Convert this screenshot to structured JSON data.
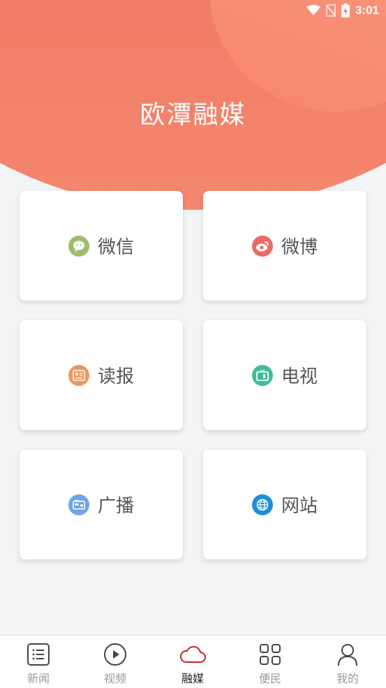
{
  "status_bar": {
    "time": "3:01"
  },
  "header": {
    "title": "欧潭融媒"
  },
  "cards": [
    {
      "label": "微信",
      "icon": "wechat-icon",
      "color": "#9dbd6e"
    },
    {
      "label": "微博",
      "icon": "weibo-icon",
      "color": "#ec6a63"
    },
    {
      "label": "读报",
      "icon": "newspaper-icon",
      "color": "#f0975a"
    },
    {
      "label": "电视",
      "icon": "tv-icon",
      "color": "#3cbf97"
    },
    {
      "label": "广播",
      "icon": "radio-icon",
      "color": "#6ea6e8"
    },
    {
      "label": "网站",
      "icon": "globe-icon",
      "color": "#1e8fd6"
    }
  ],
  "tabbar": {
    "items": [
      {
        "label": "新闻",
        "icon": "news-list-icon"
      },
      {
        "label": "视频",
        "icon": "play-circle-icon"
      },
      {
        "label": "融媒",
        "icon": "cloud-icon",
        "active": true
      },
      {
        "label": "便民",
        "icon": "grid-icon"
      },
      {
        "label": "我的",
        "icon": "user-icon"
      }
    ]
  },
  "colors": {
    "accent": "#c8202a",
    "header_start": "#e8665a",
    "header_end": "#f5876e"
  }
}
